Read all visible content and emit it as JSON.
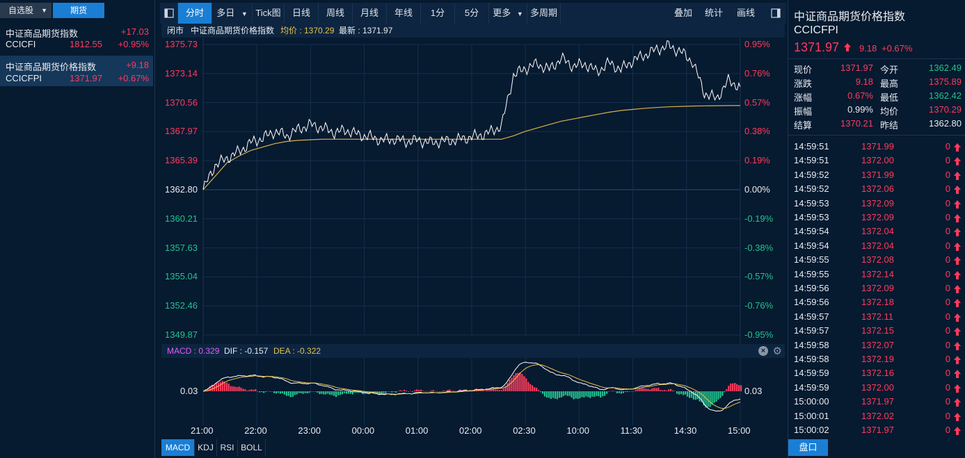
{
  "left_panel": {
    "tabs": [
      "自选股",
      "期货"
    ],
    "tab_dropdown_glyph": "▼",
    "items": [
      {
        "name": "中证商品期货指数",
        "code": "CCICFI",
        "change": "+17.03",
        "price": "1812.55",
        "pct": "+0.95%"
      },
      {
        "name": "中证商品期货价格指数",
        "code": "CCICFPI",
        "change": "+9.18",
        "price": "1371.97",
        "pct": "+0.67%"
      }
    ]
  },
  "toolbar": {
    "items": [
      "分时",
      "多日",
      "Tick图",
      "日线",
      "周线",
      "月线",
      "年线",
      "1分",
      "5分",
      "更多",
      "多周期"
    ],
    "right_items": [
      "叠加",
      "统计",
      "画线"
    ]
  },
  "info_bar": {
    "status": "闭市",
    "name": "中证商品期货价格指数",
    "avg_label": "均价 : 1370.29",
    "last_label": "最新 : 1371.97"
  },
  "price_axis": [
    "1375.73",
    "1373.14",
    "1370.56",
    "1367.97",
    "1365.39",
    "1362.80",
    "1360.21",
    "1357.63",
    "1355.04",
    "1352.46",
    "1349.87"
  ],
  "pct_axis": [
    "0.95%",
    "0.76%",
    "0.57%",
    "0.38%",
    "0.19%",
    "0.00%",
    "-0.19%",
    "-0.38%",
    "-0.57%",
    "-0.76%",
    "-0.95%"
  ],
  "time_axis": [
    "21:00",
    "22:00",
    "23:00",
    "00:00",
    "01:00",
    "02:00",
    "02:30",
    "10:00",
    "11:30",
    "14:30",
    "15:00"
  ],
  "macd": {
    "macd_label": "MACD : 0.329",
    "dif_label": "DIF : -0.157",
    "dea_label": "DEA : -0.322",
    "axis_value": "0.03"
  },
  "bottom_tabs": [
    "MACD",
    "KDJ",
    "RSI",
    "BOLL"
  ],
  "right_panel": {
    "title": "中证商品期货价格指数",
    "code": "CCICFPI",
    "price": "1371.97",
    "change": "9.18",
    "pct": "+0.67%",
    "quote": [
      {
        "l1": "现价",
        "v1": "1371.97",
        "l2": "今开",
        "v2": "1362.49"
      },
      {
        "l1": "涨跌",
        "v1": "9.18",
        "l2": "最高",
        "v2": "1375.89"
      },
      {
        "l1": "涨幅",
        "v1": "0.67%",
        "l2": "最低",
        "v2": "1362.42"
      },
      {
        "l1": "振幅",
        "v1": "0.99%",
        "l2": "均价",
        "v2": "1370.29"
      },
      {
        "l1": "结算",
        "v1": "1370.21",
        "l2": "昨结",
        "v2": "1362.80"
      }
    ],
    "ticks": [
      {
        "time": "14:59:51",
        "price": "1371.99",
        "vol": "0"
      },
      {
        "time": "14:59:51",
        "price": "1372.00",
        "vol": "0"
      },
      {
        "time": "14:59:52",
        "price": "1371.99",
        "vol": "0"
      },
      {
        "time": "14:59:52",
        "price": "1372.06",
        "vol": "0"
      },
      {
        "time": "14:59:53",
        "price": "1372.09",
        "vol": "0"
      },
      {
        "time": "14:59:53",
        "price": "1372.09",
        "vol": "0"
      },
      {
        "time": "14:59:54",
        "price": "1372.04",
        "vol": "0"
      },
      {
        "time": "14:59:54",
        "price": "1372.04",
        "vol": "0"
      },
      {
        "time": "14:59:55",
        "price": "1372.08",
        "vol": "0"
      },
      {
        "time": "14:59:55",
        "price": "1372.14",
        "vol": "0"
      },
      {
        "time": "14:59:56",
        "price": "1372.09",
        "vol": "0"
      },
      {
        "time": "14:59:56",
        "price": "1372.18",
        "vol": "0"
      },
      {
        "time": "14:59:57",
        "price": "1372.11",
        "vol": "0"
      },
      {
        "time": "14:59:57",
        "price": "1372.15",
        "vol": "0"
      },
      {
        "time": "14:59:58",
        "price": "1372.07",
        "vol": "0"
      },
      {
        "time": "14:59:58",
        "price": "1372.19",
        "vol": "0"
      },
      {
        "time": "14:59:59",
        "price": "1372.16",
        "vol": "0"
      },
      {
        "time": "14:59:59",
        "price": "1372.00",
        "vol": "0"
      },
      {
        "time": "15:00:00",
        "price": "1371.97",
        "vol": "0"
      },
      {
        "time": "15:00:01",
        "price": "1372.02",
        "vol": "0"
      },
      {
        "time": "15:00:02",
        "price": "1371.97",
        "vol": "0"
      }
    ],
    "bottom_tab": "盘口"
  },
  "colors": {
    "up": "#ff3b5c",
    "down": "#22c38e",
    "accent": "#1a7fd4",
    "avg_line": "#d9b24c",
    "price_line": "#ffffff",
    "dea_line": "#e8c14a"
  },
  "chart_data": {
    "type": "line",
    "title": "中证商品期货价格指数",
    "ylim": [
      1349.87,
      1375.73
    ],
    "x_ticks": [
      "21:00",
      "22:00",
      "23:00",
      "00:00",
      "01:00",
      "02:00",
      "02:30",
      "10:00",
      "11:30",
      "14:30",
      "15:00"
    ],
    "series": [
      {
        "name": "最新",
        "values": [
          1362.8,
          1365.0,
          1365.6,
          1366.2,
          1367.0,
          1367.4,
          1368.0,
          1367.6,
          1368.2,
          1368.6,
          1368.3,
          1367.9,
          1368.1,
          1367.7,
          1367.5,
          1367.2,
          1367.3,
          1367.1,
          1367.2,
          1367.0,
          1367.1,
          1367.2,
          1367.4,
          1367.6,
          1367.9,
          1368.5,
          1373.0,
          1373.6,
          1374.0,
          1373.5,
          1374.5,
          1373.8,
          1374.0,
          1373.3,
          1374.1,
          1373.5,
          1374.3,
          1374.8,
          1375.3,
          1375.6,
          1375.1,
          1374.2,
          1371.4,
          1370.9,
          1372.5,
          1371.97
        ]
      },
      {
        "name": "均价",
        "values": [
          1362.8,
          1364.0,
          1365.2,
          1365.8,
          1366.3,
          1366.6,
          1366.9,
          1367.1,
          1367.2,
          1367.25,
          1367.3,
          1367.3,
          1367.3,
          1367.3,
          1367.3,
          1367.3,
          1367.3,
          1367.3,
          1367.3,
          1367.3,
          1367.3,
          1367.3,
          1367.3,
          1367.3,
          1367.3,
          1367.3,
          1367.6,
          1368.0,
          1368.3,
          1368.6,
          1368.9,
          1369.1,
          1369.3,
          1369.5,
          1369.7,
          1369.85,
          1369.95,
          1370.05,
          1370.12,
          1370.18,
          1370.22,
          1370.25,
          1370.27,
          1370.28,
          1370.29,
          1370.29
        ]
      }
    ],
    "macd": {
      "macd": 0.329,
      "dif": -0.157,
      "dea": -0.322
    }
  }
}
